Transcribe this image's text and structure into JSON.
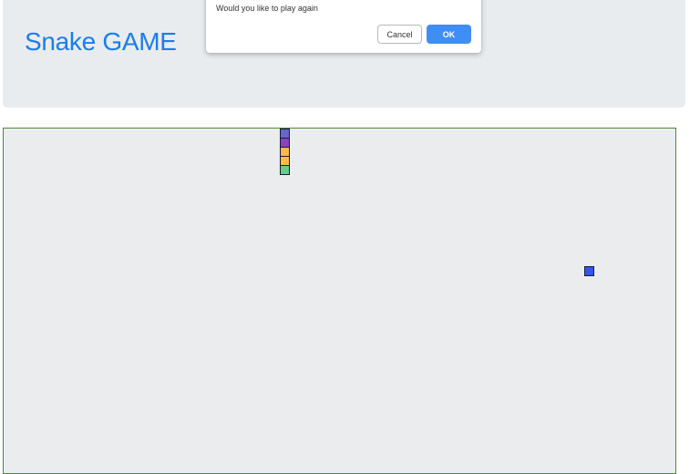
{
  "header": {
    "title": "Snake GAME",
    "background": "#e9ecef",
    "title_color": "#1a7cf2"
  },
  "dialog": {
    "message": "Would you like to play again",
    "cancel_label": "Cancel",
    "ok_label": "OK",
    "ok_color": "#3f8ef5"
  },
  "game": {
    "board_background": "#eaecee",
    "board_border_color": "#4a8a34",
    "snake_segment_colors": [
      "#6666cc",
      "#8844bb",
      "#ffbb44",
      "#ffbb44",
      "#66cc88"
    ],
    "food_color": "#3355ee"
  }
}
